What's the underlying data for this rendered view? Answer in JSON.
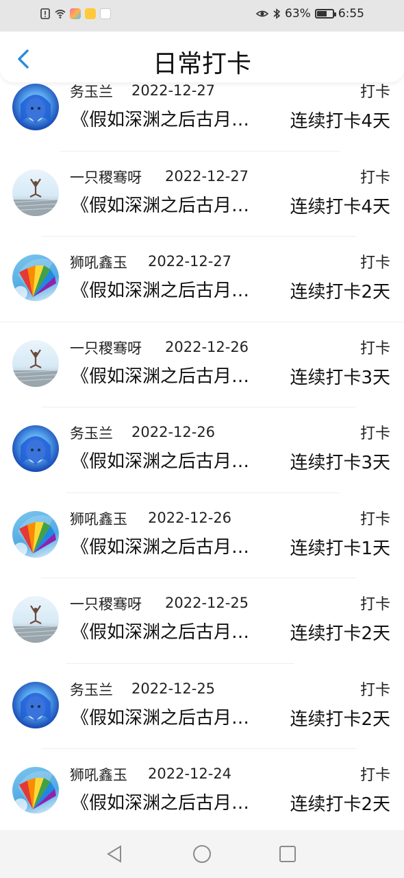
{
  "status_bar": {
    "battery_percent": "63%",
    "battery_level": 0.63,
    "time": "6:55",
    "icons": [
      "alert-icon",
      "wifi-icon",
      "app-icon-1",
      "app-icon-2",
      "app-icon-3",
      "eye-icon",
      "bluetooth-icon",
      "battery-icon"
    ]
  },
  "header": {
    "title": "日常打卡",
    "back_icon": "chevron-left-icon",
    "accent": "#2a8be0"
  },
  "records": [
    {
      "user": "务玉兰",
      "date": "2022-12-27",
      "tag": "打卡",
      "book": "《假如深渊之后古月…",
      "streak": "连续打卡4天",
      "avatar": "anime"
    },
    {
      "user": "一只稷骞呀",
      "date": "2022-12-27",
      "tag": "打卡",
      "book": "《假如深渊之后古月…",
      "streak": "连续打卡4天",
      "avatar": "yoga"
    },
    {
      "user": "狮吼鑫玉",
      "date": "2022-12-27",
      "tag": "打卡",
      "book": "《假如深渊之后古月…",
      "streak": "连续打卡2天",
      "avatar": "fan"
    },
    {
      "user": "一只稷骞呀",
      "date": "2022-12-26",
      "tag": "打卡",
      "book": "《假如深渊之后古月…",
      "streak": "连续打卡3天",
      "avatar": "yoga"
    },
    {
      "user": "务玉兰",
      "date": "2022-12-26",
      "tag": "打卡",
      "book": "《假如深渊之后古月…",
      "streak": "连续打卡3天",
      "avatar": "anime"
    },
    {
      "user": "狮吼鑫玉",
      "date": "2022-12-26",
      "tag": "打卡",
      "book": "《假如深渊之后古月…",
      "streak": "连续打卡1天",
      "avatar": "fan"
    },
    {
      "user": "一只稷骞呀",
      "date": "2022-12-25",
      "tag": "打卡",
      "book": "《假如深渊之后古月…",
      "streak": "连续打卡2天",
      "avatar": "yoga"
    },
    {
      "user": "务玉兰",
      "date": "2022-12-25",
      "tag": "打卡",
      "book": "《假如深渊之后古月…",
      "streak": "连续打卡2天",
      "avatar": "anime"
    },
    {
      "user": "狮吼鑫玉",
      "date": "2022-12-24",
      "tag": "打卡",
      "book": "《假如深渊之后古月…",
      "streak": "连续打卡2天",
      "avatar": "fan"
    }
  ],
  "nav_bar": {
    "icons": [
      "back-triangle-icon",
      "home-circle-icon",
      "recents-square-icon"
    ]
  }
}
